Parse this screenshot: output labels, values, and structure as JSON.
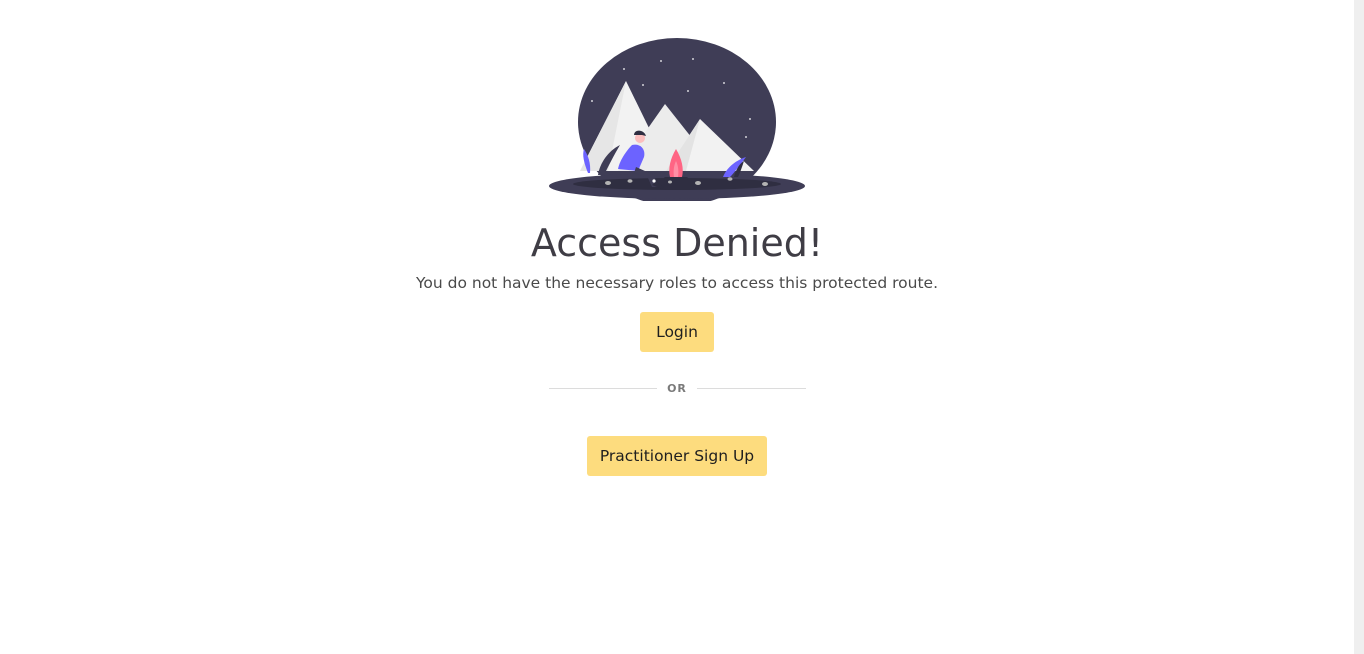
{
  "heading": "Access Denied!",
  "message": "You do not have the necessary roles to access this protected route.",
  "login_button": "Login",
  "divider_label": "OR",
  "signup_button": "Practitioner Sign Up",
  "illustration": {
    "icon": "camping-night-mountains-illustration",
    "colors": {
      "sky": "#3f3d56",
      "mountain": "#f2f2f2",
      "fire": "#ff6584",
      "person": "#6c63ff"
    }
  },
  "colors": {
    "button_bg": "#fddc7e",
    "heading": "#3f3d45",
    "text": "#4a4a4a"
  }
}
